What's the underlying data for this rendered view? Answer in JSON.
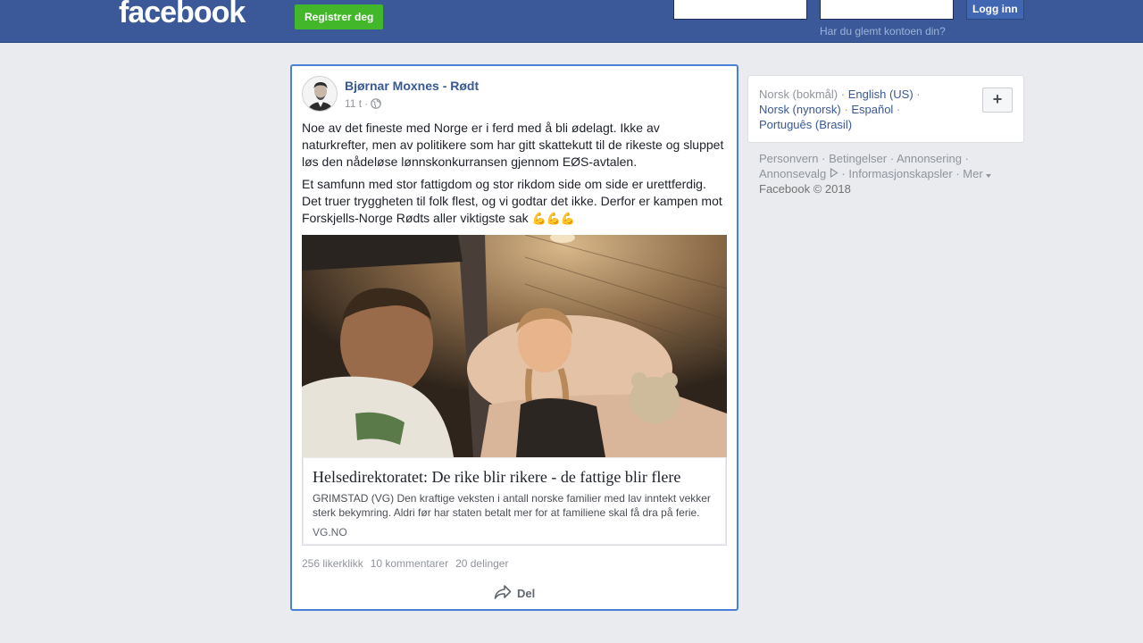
{
  "header": {
    "logo_text": "facebook",
    "register_label": "Registrer deg",
    "login_label": "Logg inn",
    "forgot_label": "Har du glemt kontoen din?",
    "email_value": "",
    "password_value": ""
  },
  "post": {
    "author": "Bjørnar Moxnes - Rødt",
    "time": "11 t",
    "meta_sep": "·",
    "paragraph1": "Noe av det fineste med Norge er i ferd med å bli ødelagt. Ikke av naturkrefter, men av politikere som har gitt skattekutt til de rikeste og sluppet løs den nådeløse lønnskonkurransen gjennom EØS-avtalen.",
    "paragraph2": "Et samfunn med stor fattigdom og stor rikdom side om side er urettferdig. Det truer tryggheten til folk flest, og vi godtar det ikke. Derfor er kampen mot Forskjells-Norge Rødts aller viktigste sak",
    "emojis": "💪💪💪",
    "link": {
      "title": "Helsedirektoratet: De rike blir rikere - de fattige blir flere",
      "description": "GRIMSTAD (VG) Den kraftige veksten i antall norske familier med lav inntekt vekker sterk bekymring. Aldri før har staten betalt mer for at familiene skal få dra på ferie.",
      "domain": "VG.NO"
    },
    "likes": "256 likerklikk",
    "comments": "10 kommentarer",
    "shares": "20 delinger",
    "share_label": "Del"
  },
  "languages": {
    "current": "Norsk (bokmål)",
    "items": [
      "English (US)",
      "Norsk (nynorsk)",
      "Español",
      "Português (Brasil)"
    ],
    "add_label": "+"
  },
  "footer": {
    "links": [
      "Personvern",
      "Betingelser",
      "Annonsering",
      "Annonsevalg",
      "Informasjonskapsler",
      "Mer"
    ],
    "copyright": "Facebook © 2018"
  },
  "colors": {
    "brand": "#3b5998",
    "register": "#42b72a",
    "link": "#385898",
    "focus_border": "#4a80d8"
  }
}
